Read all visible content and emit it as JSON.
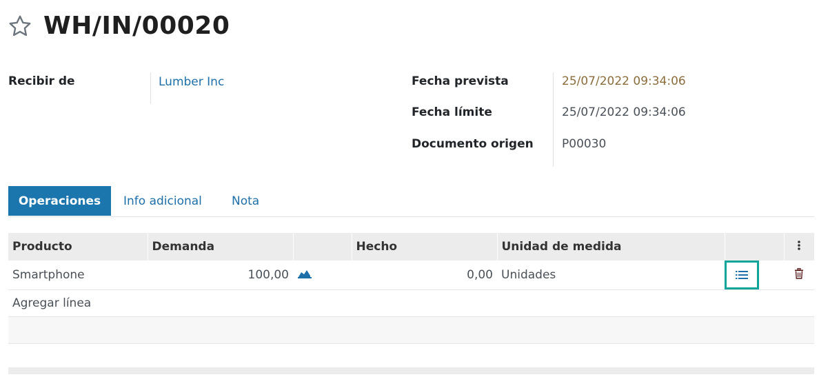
{
  "header": {
    "title": "WH/IN/00020",
    "favorite_icon": "star-icon"
  },
  "form": {
    "receive_from_label": "Recibir de",
    "receive_from_value": "Lumber Inc",
    "scheduled_date_label": "Fecha prevista",
    "scheduled_date_value": "25/07/2022 09:34:06",
    "deadline_label": "Fecha límite",
    "deadline_value": "25/07/2022 09:34:06",
    "source_doc_label": "Documento origen",
    "source_doc_value": "P00030"
  },
  "tabs": [
    {
      "label": "Operaciones",
      "active": true
    },
    {
      "label": "Info adicional",
      "active": false
    },
    {
      "label": "Nota",
      "active": false
    }
  ],
  "table": {
    "headers": [
      "Producto",
      "Demanda",
      "",
      "Hecho",
      "Unidad de medida"
    ],
    "rows": [
      {
        "product": "Smartphone",
        "demand": "100,00",
        "done": "0,00",
        "uom": "Unidades"
      }
    ],
    "add_line": "Agregar línea"
  },
  "colors": {
    "accent": "#1b76ad",
    "link": "#1d6fa8",
    "date_warning": "#8a6d3b",
    "highlight": "#0fa39a"
  }
}
